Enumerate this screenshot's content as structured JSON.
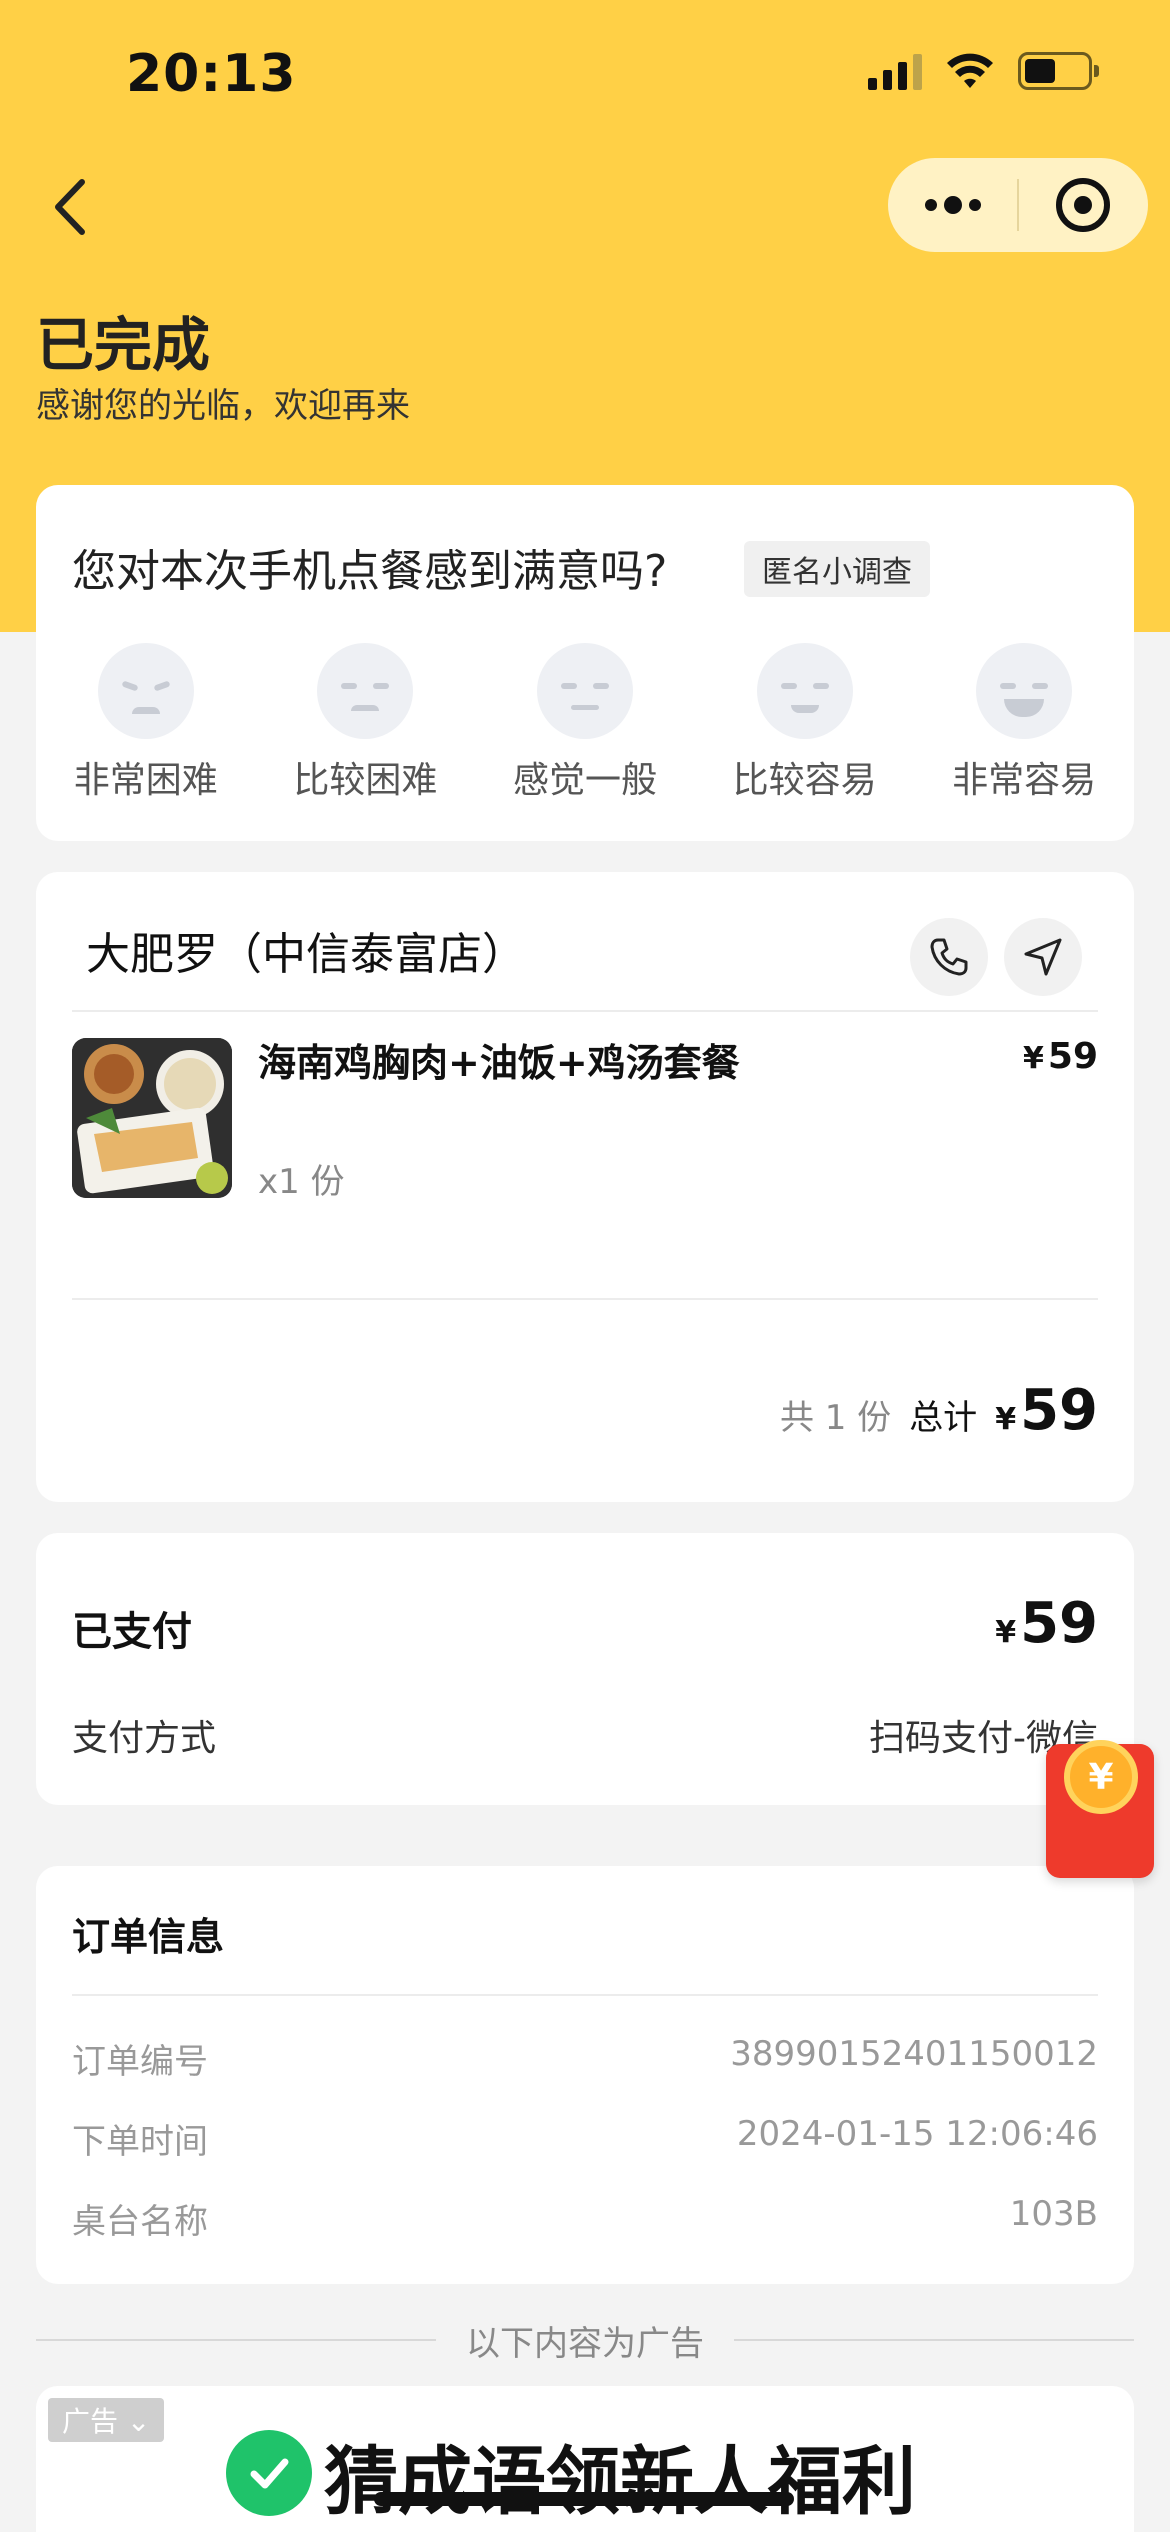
{
  "status_bar": {
    "time": "20:13"
  },
  "header": {
    "title": "已完成",
    "subtitle": "感谢您的光临，欢迎再来"
  },
  "survey": {
    "question": "您对本次手机点餐感到满意吗?",
    "tag": "匿名小调查",
    "options": [
      "非常困难",
      "比较困难",
      "感觉一般",
      "比较容易",
      "非常容易"
    ]
  },
  "store": {
    "name": "大肥罗（中信泰富店）",
    "item": {
      "name": "海南鸡胸肉+油饭+鸡汤套餐",
      "price": "59",
      "qty": "x1 份"
    },
    "total_count": "共 1 份",
    "total_label": "总计",
    "total_amount": "59",
    "currency": "¥"
  },
  "payment": {
    "title": "已支付",
    "amount": "59",
    "method_label": "支付方式",
    "method_value": "扫码支付-微信"
  },
  "order_info": {
    "title": "订单信息",
    "rows": [
      {
        "label": "订单编号",
        "value": "38990152401150012"
      },
      {
        "label": "下单时间",
        "value": "2024-01-15 12:06:46"
      },
      {
        "label": "桌台名称",
        "value": "103B"
      }
    ]
  },
  "ad": {
    "separator": "以下内容为广告",
    "tag": "广告",
    "title": "猜成语领新人福利"
  },
  "colors": {
    "brand_yellow": "#ffd046",
    "ad_green": "#1fc36a",
    "red_packet": "#ee3a2c"
  }
}
